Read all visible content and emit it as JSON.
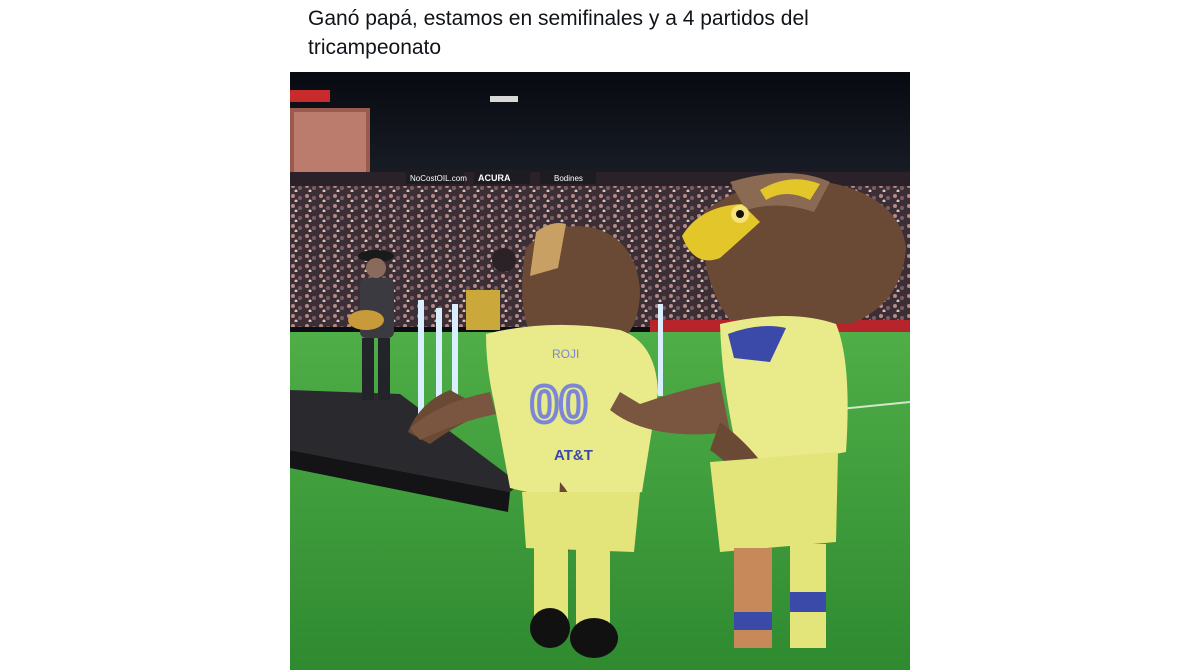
{
  "post": {
    "text": "Ganó papá, estamos en semifinales y a 4 partidos del tricampeonato"
  },
  "media": {
    "type": "video-still",
    "jersey": {
      "number": "00",
      "name": "ROJI",
      "sponsor": "AT&T"
    },
    "banners": {
      "board1": "NoCostOIL.com",
      "board2": "ACURA",
      "board3": "Bodines"
    }
  },
  "colors": {
    "field": "#3f9a3c",
    "jersey": "#e9ea8a",
    "jersey_number": "#7b86d6",
    "mascot_brown": "#6b4a35",
    "beak": "#e3c62a",
    "stands": "#3a2e33"
  }
}
